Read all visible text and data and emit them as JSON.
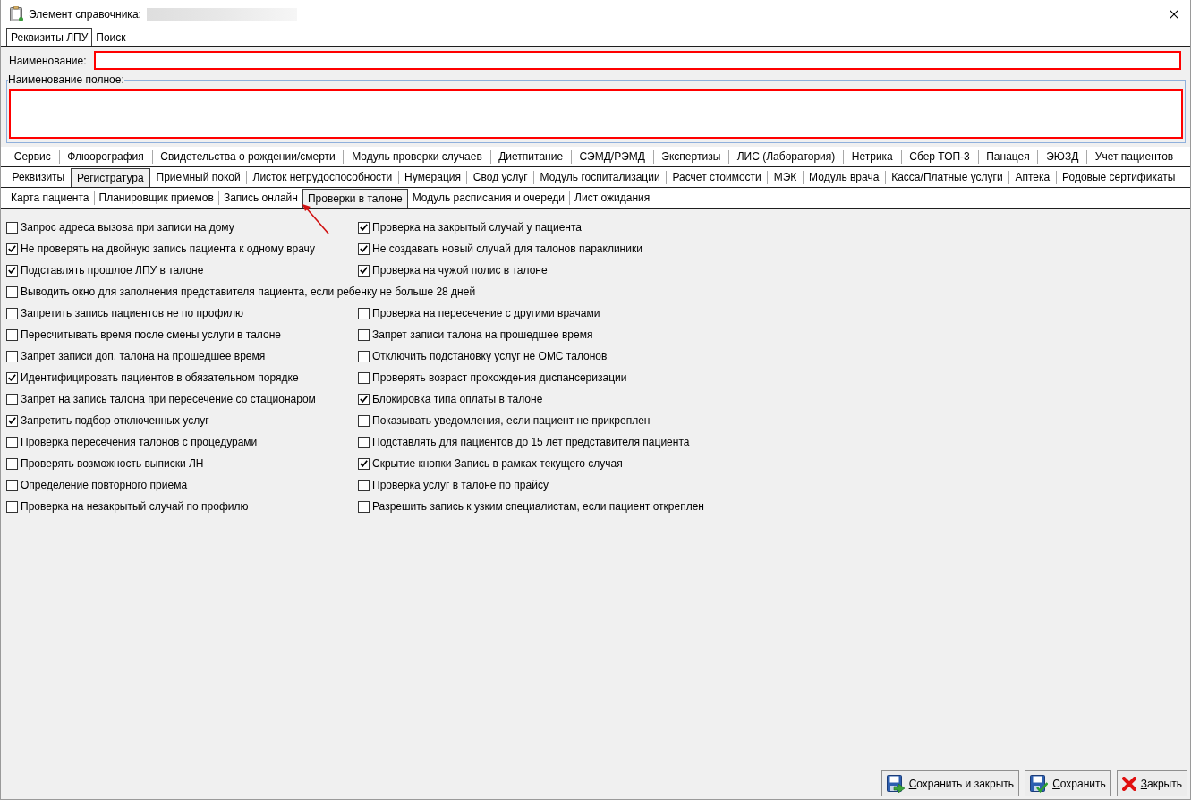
{
  "window": {
    "title": "Элемент справочника:"
  },
  "top_tabs": [
    {
      "label": "Реквизиты ЛПУ",
      "selected": true
    },
    {
      "label": "Поиск",
      "selected": false
    }
  ],
  "name_field": {
    "label": "Наименование:",
    "invalid": true
  },
  "full_name_group": {
    "title": "Наименование полное:",
    "invalid": true
  },
  "module_tab_rows": [
    {
      "tabs": [
        {
          "label": "Сервис",
          "selected": false
        },
        {
          "label": "Флюорография",
          "selected": false
        },
        {
          "label": "Свидетельства о рождении/смерти",
          "selected": false
        },
        {
          "label": "Модуль проверки случаев",
          "selected": false
        },
        {
          "label": "Диетпитание",
          "selected": false
        },
        {
          "label": "СЭМД/РЭМД",
          "selected": false
        },
        {
          "label": "Экспертизы",
          "selected": false
        },
        {
          "label": "ЛИС (Лаборатория)",
          "selected": false
        },
        {
          "label": "Нетрика",
          "selected": false
        },
        {
          "label": "Сбер ТОП-3",
          "selected": false
        },
        {
          "label": "Панацея",
          "selected": false
        },
        {
          "label": "ЭЮЗД",
          "selected": false
        },
        {
          "label": "Учет пациентов",
          "selected": false
        }
      ]
    },
    {
      "tabs": [
        {
          "label": "Реквизиты",
          "selected": false
        },
        {
          "label": "Регистратура",
          "selected": true
        },
        {
          "label": "Приемный покой",
          "selected": false
        },
        {
          "label": "Листок нетрудоспособности",
          "selected": false
        },
        {
          "label": "Нумерация",
          "selected": false
        },
        {
          "label": "Свод услуг",
          "selected": false
        },
        {
          "label": "Модуль госпитализации",
          "selected": false
        },
        {
          "label": "Расчет стоимости",
          "selected": false
        },
        {
          "label": "МЭК",
          "selected": false
        },
        {
          "label": "Модуль врача",
          "selected": false
        },
        {
          "label": "Касса/Платные услуги",
          "selected": false
        },
        {
          "label": "Аптека",
          "selected": false
        },
        {
          "label": "Родовые сертификаты",
          "selected": false
        }
      ]
    }
  ],
  "registry_tabs": [
    {
      "label": "Карта пациента",
      "selected": false
    },
    {
      "label": "Планировщик приемов",
      "selected": false
    },
    {
      "label": "Запись онлайн",
      "selected": false
    },
    {
      "label": "Проверки в талоне",
      "selected": true
    },
    {
      "label": "Модуль расписания и очереди",
      "selected": false
    },
    {
      "label": "Лист ожидания",
      "selected": false
    }
  ],
  "options": [
    {
      "items": [
        {
          "label": "Запрос адреса вызова при записи на дому",
          "checked": false
        },
        {
          "label": "Проверка на закрытый случай у пациента",
          "checked": true
        }
      ]
    },
    {
      "items": [
        {
          "label": "Не проверять на двойную запись пациента к одному врачу",
          "checked": true
        },
        {
          "label": "Не создавать новый случай для талонов параклиники",
          "checked": true
        }
      ]
    },
    {
      "items": [
        {
          "label": "Подставлять прошлое ЛПУ в талоне",
          "checked": true
        },
        {
          "label": "Проверка на чужой полис в талоне",
          "checked": true
        }
      ]
    },
    {
      "items": [
        {
          "label": "Выводить окно для заполнения представителя пациента, если ребенку не больше 28 дней",
          "checked": false
        }
      ]
    },
    {
      "items": [
        {
          "label": "Запретить запись пациентов не по профилю",
          "checked": false
        },
        {
          "label": "Проверка на пересечение с другими врачами",
          "checked": false
        }
      ]
    },
    {
      "items": [
        {
          "label": "Пересчитывать время после смены услуги в талоне",
          "checked": false
        },
        {
          "label": "Запрет записи талона на прошедшее время",
          "checked": false
        }
      ]
    },
    {
      "items": [
        {
          "label": "Запрет записи доп. талона на прошедшее время",
          "checked": false
        },
        {
          "label": "Отключить подстановку услуг не ОМС талонов",
          "checked": false
        }
      ]
    },
    {
      "items": [
        {
          "label": "Идентифицировать пациентов в обязательном порядке",
          "checked": true
        },
        {
          "label": "Проверять возраст прохождения диспансеризации",
          "checked": false
        }
      ]
    },
    {
      "items": [
        {
          "label": "Запрет на запись талона при пересечение со стационаром",
          "checked": false
        },
        {
          "label": "Блокировка типа оплаты в талоне",
          "checked": true
        }
      ]
    },
    {
      "items": [
        {
          "label": "Запретить подбор отключенных услуг",
          "checked": true
        },
        {
          "label": "Показывать уведомления, если пациент не прикреплен",
          "checked": false
        }
      ]
    },
    {
      "items": [
        {
          "label": "Проверка пересечения талонов с процедурами",
          "checked": false
        },
        {
          "label": "Подставлять для пациентов до 15 лет представителя пациента",
          "checked": false
        }
      ]
    },
    {
      "items": [
        {
          "label": "Проверять возможность выписки ЛН",
          "checked": false
        },
        {
          "label": "Скрытие кнопки Запись в рамках текущего случая",
          "checked": true
        }
      ]
    },
    {
      "items": [
        {
          "label": "Определение повторного приема",
          "checked": false
        },
        {
          "label": "Проверка услуг в талоне по прайсу",
          "checked": false
        }
      ]
    },
    {
      "items": [
        {
          "label": "Проверка на незакрытый случай по профилю",
          "checked": false
        },
        {
          "label": "Разрешить запись к узким специалистам, если пациент откреплен",
          "checked": false
        }
      ]
    }
  ],
  "buttons": [
    {
      "label": "Сохранить и закрыть",
      "kind": "save_close"
    },
    {
      "label": "Сохранить",
      "kind": "save"
    },
    {
      "label": "Закрыть",
      "kind": "close"
    }
  ]
}
